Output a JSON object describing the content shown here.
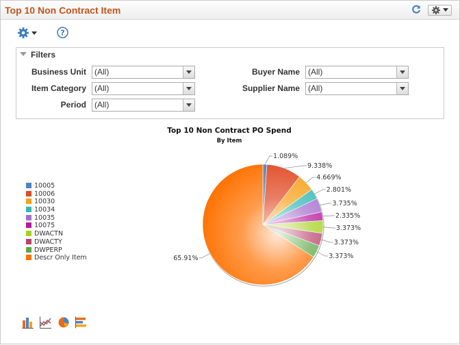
{
  "header": {
    "title": "Top 10 Non Contract Item",
    "refresh_icon": "refresh-icon",
    "actions_icon": "gear-icon"
  },
  "toolbar": {
    "settings_icon": "gear-icon",
    "help_icon": "help-icon"
  },
  "filters": {
    "title": "Filters",
    "business_unit": {
      "label": "Business Unit",
      "value": "(All)"
    },
    "item_category": {
      "label": "Item Category",
      "value": "(All)"
    },
    "period": {
      "label": "Period",
      "value": "(All)"
    },
    "buyer_name": {
      "label": "Buyer Name",
      "value": "(All)"
    },
    "supplier_name": {
      "label": "Supplier Name",
      "value": "(All)"
    }
  },
  "chart_data": {
    "type": "pie",
    "title": "Top 10 Non Contract PO Spend",
    "subtitle": "By Item",
    "legend_position": "left",
    "slices": [
      {
        "label": "10005",
        "value": 1.089,
        "display": "1.089%",
        "color": "#4f81bd"
      },
      {
        "label": "10006",
        "value": 9.338,
        "display": "9.338%",
        "color": "#e04a26"
      },
      {
        "label": "10030",
        "value": 4.669,
        "display": "4.669%",
        "color": "#f7a11a"
      },
      {
        "label": "10034",
        "value": 2.801,
        "display": "2.801%",
        "color": "#33b8b4"
      },
      {
        "label": "10035",
        "value": 3.735,
        "display": "3.735%",
        "color": "#a56dcd"
      },
      {
        "label": "10075",
        "value": 2.335,
        "display": "2.335%",
        "color": "#b5179e"
      },
      {
        "label": "DWACTN",
        "value": 3.373,
        "display": "3.373%",
        "color": "#a5d01c"
      },
      {
        "label": "DWACTY",
        "value": 3.373,
        "display": "3.373%",
        "color": "#b8426b"
      },
      {
        "label": "DWPERP",
        "value": 3.373,
        "display": "3.373%",
        "color": "#5aa944"
      },
      {
        "label": "Descr Only Item",
        "value": 65.91,
        "display": "65.91%",
        "color": "#ff7100"
      }
    ]
  },
  "chart_types": [
    {
      "name": "bar-chart-icon",
      "colors": [
        "#e56b1f",
        "#4f81bd",
        "#f7a11a"
      ]
    },
    {
      "name": "line-chart-icon",
      "colors": [
        "#4f81bd",
        "#e04a26"
      ]
    },
    {
      "name": "pie-chart-icon",
      "colors": [
        "#4f81bd",
        "#e56b1f",
        "#f7a11a"
      ]
    },
    {
      "name": "horizontal-bar-chart-icon",
      "colors": [
        "#4f81bd",
        "#e56b1f",
        "#f7a11a"
      ]
    }
  ]
}
